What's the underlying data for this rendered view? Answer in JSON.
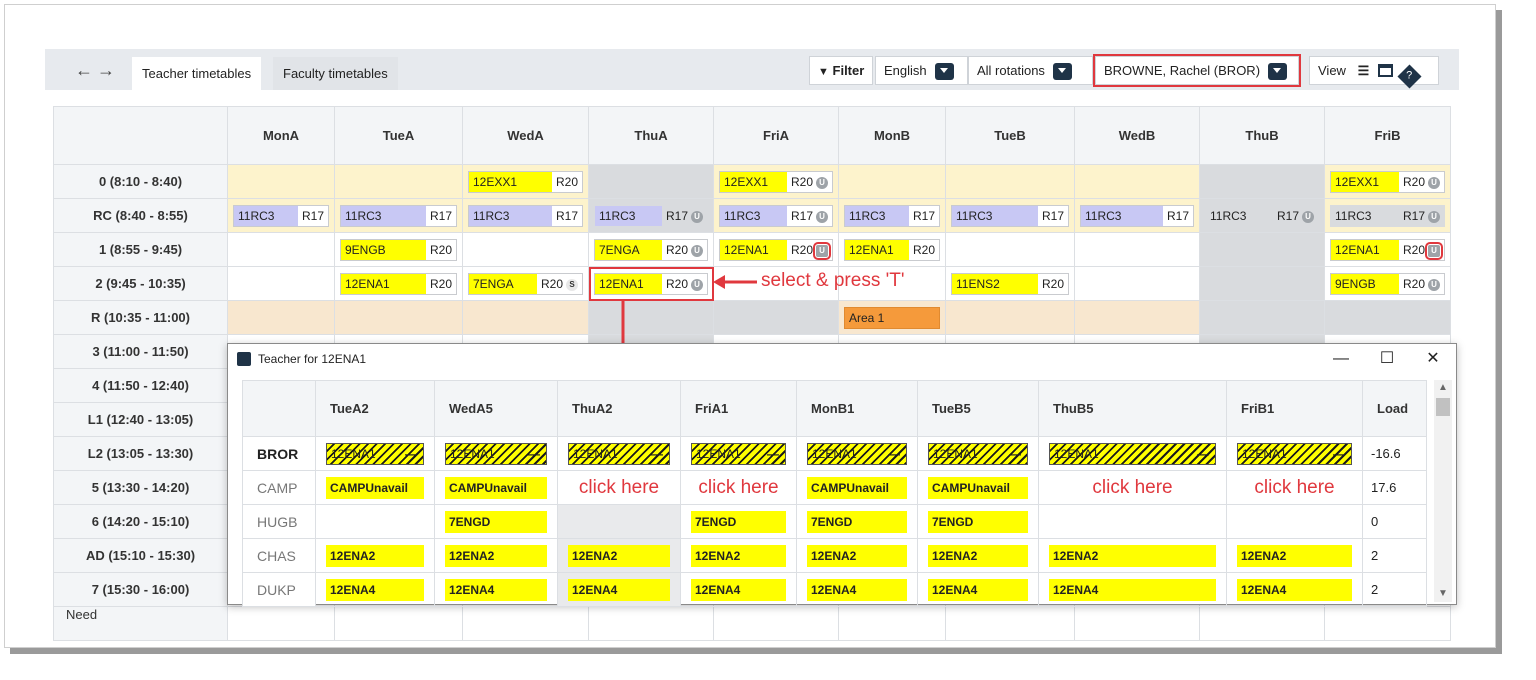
{
  "toolbar": {
    "back_icon": "←",
    "forward_icon": "→",
    "tabs": [
      {
        "label": "Teacher timetables"
      },
      {
        "label": "Faculty timetables"
      }
    ],
    "filter_label": "Filter",
    "language": "English",
    "rotation": "All rotations",
    "teacher": "BROWNE, Rachel (BROR)",
    "view_label": "View"
  },
  "grid": {
    "days": [
      "MonA",
      "TueA",
      "WedA",
      "ThuA",
      "FriA",
      "MonB",
      "TueB",
      "WedB",
      "ThuB",
      "FriB"
    ],
    "periods": [
      {
        "label": "0  (8:10 - 8:40)"
      },
      {
        "label": "RC  (8:40 - 8:55)"
      },
      {
        "label": "1  (8:55 - 9:45)"
      },
      {
        "label": "2  (9:45 - 10:35)"
      },
      {
        "label": "R  (10:35 - 11:00)"
      },
      {
        "label": "3  (11:00 - 11:50)"
      },
      {
        "label": "4  (11:50 - 12:40)"
      },
      {
        "label": "L1  (12:40 - 13:05)"
      },
      {
        "label": "L2  (13:05 - 13:30)"
      },
      {
        "label": "5  (13:30 - 14:20)"
      },
      {
        "label": "6  (14:20 - 15:10)"
      },
      {
        "label": "AD  (15:10 - 15:30)"
      },
      {
        "label": "7  (15:30 - 16:00)"
      }
    ],
    "need_label": "Need",
    "lessons": {
      "p0_wedA": {
        "cls": "12EXX1",
        "room": "R20"
      },
      "p0_friA": {
        "cls": "12EXX1",
        "room": "R20"
      },
      "p0_friB": {
        "cls": "12EXX1",
        "room": "R20"
      },
      "rc_monA": {
        "cls": "11RC3",
        "room": "R17"
      },
      "rc_tueA": {
        "cls": "11RC3",
        "room": "R17"
      },
      "rc_wedA": {
        "cls": "11RC3",
        "room": "R17"
      },
      "rc_thuA": {
        "cls": "11RC3",
        "room": "R17"
      },
      "rc_friA": {
        "cls": "11RC3",
        "room": "R17"
      },
      "rc_monB": {
        "cls": "11RC3",
        "room": "R17"
      },
      "rc_tueB": {
        "cls": "11RC3",
        "room": "R17"
      },
      "rc_wedB": {
        "cls": "11RC3",
        "room": "R17"
      },
      "rc_thuB": {
        "cls": "11RC3",
        "room": "R17"
      },
      "rc_friB": {
        "cls": "11RC3",
        "room": "R17"
      },
      "p1_tueA": {
        "cls": "9ENGB",
        "room": "R20"
      },
      "p1_thuA": {
        "cls": "7ENGA",
        "room": "R20"
      },
      "p1_friA": {
        "cls": "12ENA1",
        "room": "R20"
      },
      "p1_monB": {
        "cls": "12ENA1",
        "room": "R20"
      },
      "p1_friB": {
        "cls": "12ENA1",
        "room": "R20"
      },
      "p2_tueA": {
        "cls": "12ENA1",
        "room": "R20"
      },
      "p2_wedA": {
        "cls": "7ENGA",
        "room": "R20"
      },
      "p2_thuA": {
        "cls": "12ENA1",
        "room": "R20"
      },
      "p2_tueB": {
        "cls": "11ENS2",
        "room": "R20"
      },
      "p2_friB": {
        "cls": "9ENGB",
        "room": "R20"
      },
      "r_monB": {
        "cls": "Area 1"
      }
    },
    "badge_u": "U",
    "badge_s": "S"
  },
  "annotation": "select & press 'T'",
  "dialog": {
    "title": "Teacher for 12ENA1",
    "columns": [
      "TueA2",
      "WedA5",
      "ThuA2",
      "FriA1",
      "MonB1",
      "TueB5",
      "ThuB5",
      "FriB1",
      "Load"
    ],
    "rows": [
      {
        "teacher": "BROR",
        "cells": [
          "12ENA1",
          "12ENA1",
          "12ENA1",
          "12ENA1",
          "12ENA1",
          "12ENA1",
          "12ENA1",
          "12ENA1"
        ],
        "load": "-16.6"
      },
      {
        "teacher": "CAMP",
        "cells": [
          "CAMPUnavail",
          "CAMPUnavail",
          "click here",
          "click here",
          "CAMPUnavail",
          "CAMPUnavail",
          "click here",
          "click here"
        ],
        "load": "17.6"
      },
      {
        "teacher": "HUGB",
        "cells": [
          "",
          "7ENGD",
          "",
          "7ENGD",
          "7ENGD",
          "7ENGD",
          "",
          ""
        ],
        "load": "0"
      },
      {
        "teacher": "CHAS",
        "cells": [
          "12ENA2",
          "12ENA2",
          "12ENA2",
          "12ENA2",
          "12ENA2",
          "12ENA2",
          "12ENA2",
          "12ENA2"
        ],
        "load": "2"
      },
      {
        "teacher": "DUKP",
        "cells": [
          "12ENA4",
          "12ENA4",
          "12ENA4",
          "12ENA4",
          "12ENA4",
          "12ENA4",
          "12ENA4",
          "12ENA4"
        ],
        "load": "2"
      }
    ],
    "minus": "—"
  },
  "colors": {
    "accent_red": "#e0383e",
    "lesson_yellow": "#ffff00",
    "rc_lavender": "#c8c8f4",
    "area_orange": "#f59a3b",
    "navy": "#1f3347"
  }
}
